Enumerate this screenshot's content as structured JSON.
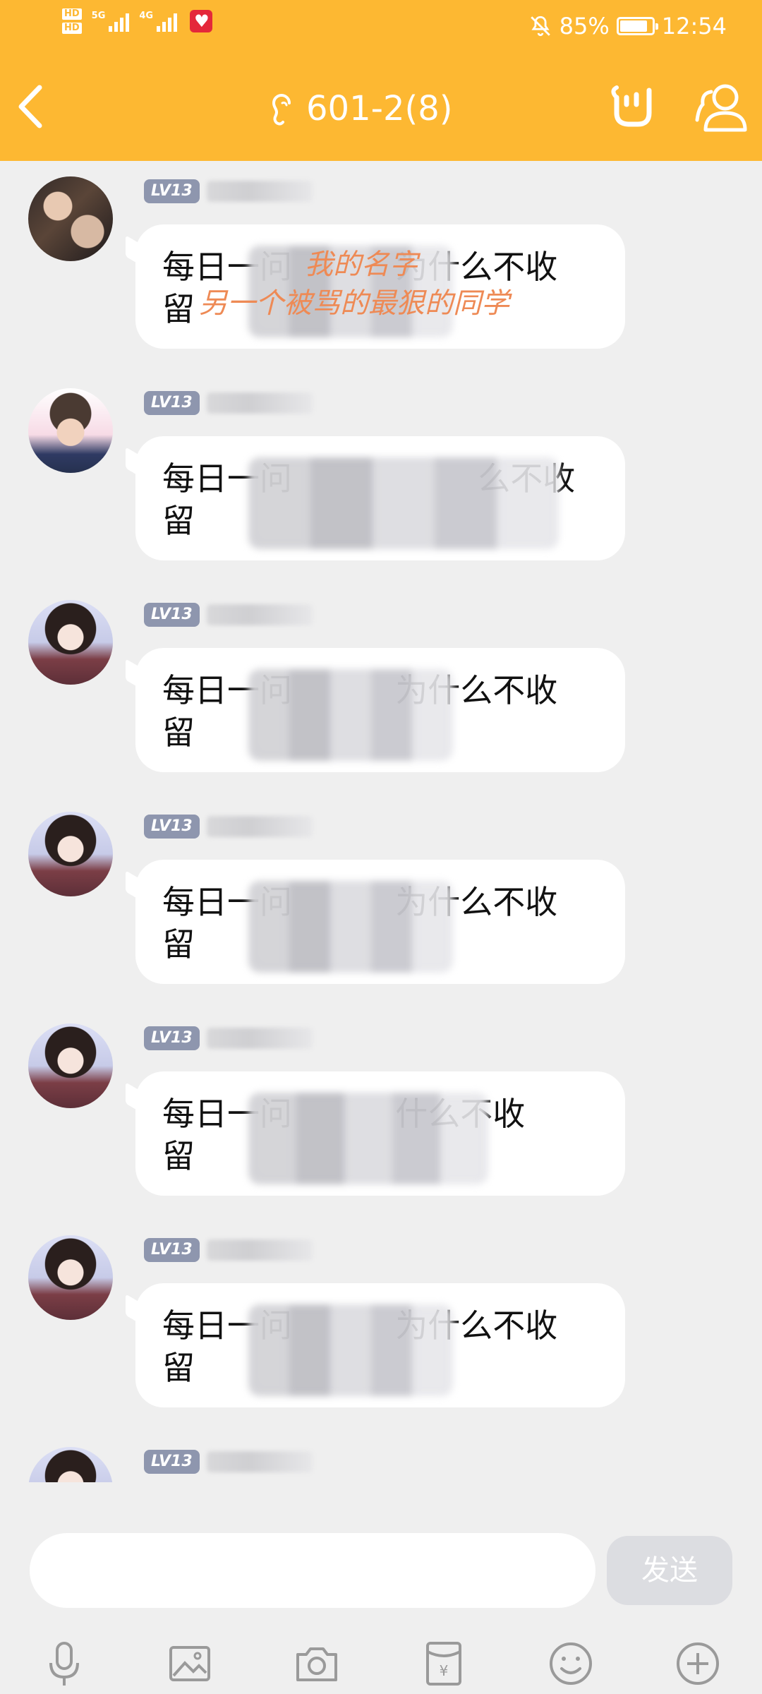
{
  "status_bar": {
    "left": {
      "hd1": "HD",
      "hd2": "HD",
      "net1": "5G",
      "net2": "4G"
    },
    "right": {
      "battery": "85%",
      "time": "12:54"
    }
  },
  "header": {
    "title": "601-2(8)"
  },
  "messages": [
    {
      "level": "LV13",
      "text": "每日一问          为什么不收\n留",
      "overlay": "我的名字 另一个被骂的最狠的同学"
    },
    {
      "level": "LV13",
      "text": "每日一问                  么不收\n留",
      "overlay": ""
    },
    {
      "level": "LV13",
      "text": "每日一问          为什么不收\n留",
      "overlay": ""
    },
    {
      "level": "LV13",
      "text": "每日一问          为什么不收\n留",
      "overlay": ""
    },
    {
      "level": "LV13",
      "text": "每日一问          什么不收\n留",
      "overlay": ""
    },
    {
      "level": "LV13",
      "text": "每日一问          为什么不收\n留",
      "overlay": ""
    },
    {
      "level": "LV13",
      "text": "",
      "overlay": ""
    }
  ],
  "input_bar": {
    "placeholder": "",
    "send_label": "发送"
  },
  "icons": [
    "mic-icon",
    "image-icon",
    "camera-icon",
    "red-packet-icon",
    "emoji-icon",
    "plus-icon"
  ]
}
